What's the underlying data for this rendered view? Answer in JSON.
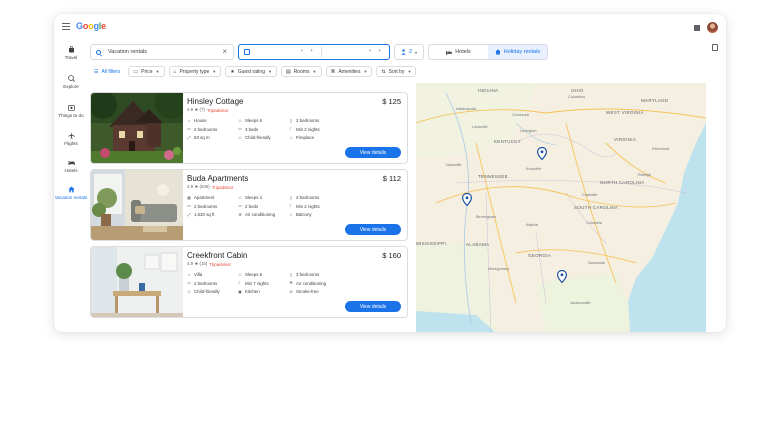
{
  "app": {
    "logo": "Google"
  },
  "nav": [
    {
      "label": "Travel",
      "icon": "suitcase-icon"
    },
    {
      "label": "Explore",
      "icon": "explore-icon"
    },
    {
      "label": "Things to do",
      "icon": "camera-icon"
    },
    {
      "label": "Flights",
      "icon": "airplane-icon"
    },
    {
      "label": "Hotels",
      "icon": "bed-icon"
    },
    {
      "label": "Vacation rentals",
      "icon": "home-icon",
      "active": true
    }
  ],
  "search": {
    "value": "Vacation rentals"
  },
  "guests": {
    "count": "2"
  },
  "tabs": {
    "hotels": "Hotels",
    "rentals": "Holiday rentals"
  },
  "filters": [
    "All filters",
    "Price",
    "Property type",
    "Guest rating",
    "Rooms",
    "Amenities",
    "Sort by"
  ],
  "listings": [
    {
      "name": "Hinsley Cottage",
      "price": "$ 125",
      "rating": "4.9 ★ (7)",
      "source": "Tripadvisor",
      "features": [
        "House",
        "Sleeps 6",
        "2 bedrooms",
        "2 bedrooms",
        "3 beds",
        "Min 2 nights",
        "93 sq m",
        "Child-friendly",
        "Fireplace"
      ],
      "button": "View details"
    },
    {
      "name": "Buda Apartments",
      "price": "$ 112",
      "rating": "4.9 ★ (845)",
      "source": "Tripadvisor",
      "features": [
        "Apartment",
        "Sleeps 4",
        "2 bedrooms",
        "2 bedrooms",
        "2 beds",
        "Min 2 nights",
        "1,620 sq ft",
        "Air conditioning",
        "Balcony"
      ],
      "button": "View details"
    },
    {
      "name": "Creekfront Cabin",
      "price": "$ 160",
      "rating": "4.9 ★ (15)",
      "source": "Tripadvisor",
      "features": [
        "Villa",
        "Sleeps 6",
        "3 bedrooms",
        "2 bedrooms",
        "Min 7 nights",
        "Air conditioning",
        "Child-friendly",
        "Kitchen",
        "Smoke-free"
      ],
      "button": "View details"
    }
  ],
  "map": {
    "states": [
      "INDIANA",
      "OHIO",
      "MARYLAND",
      "WEST VIRGINIA",
      "KENTUCKY",
      "VIRGINIA",
      "TENNESSEE",
      "NORTH CAROLINA",
      "SOUTH CAROLINA",
      "ALABAMA",
      "GEORGIA",
      "MISSISSIPPI"
    ],
    "cities": [
      "Indianapolis",
      "Columbus",
      "Cincinnati",
      "Louisville",
      "Lexington",
      "Nashville",
      "Knoxville",
      "Charlotte",
      "Atlanta",
      "Birmingham",
      "Montgomery",
      "Columbia",
      "Savannah",
      "Richmond",
      "Raleigh",
      "Jacksonville"
    ]
  }
}
